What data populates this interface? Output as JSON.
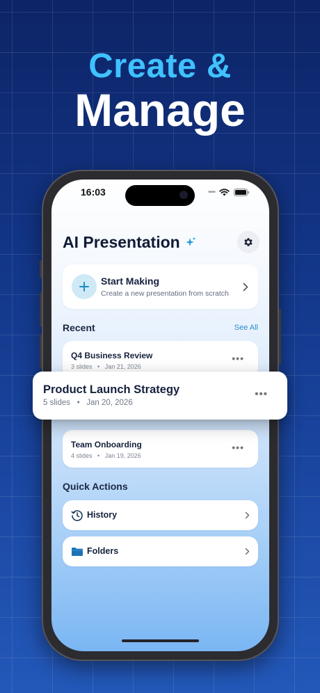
{
  "headline": {
    "line1": "Create &",
    "line2": "Manage"
  },
  "status_bar": {
    "time": "16:03",
    "icons": [
      "signal-dots-icon",
      "wifi-icon",
      "battery-icon"
    ]
  },
  "header": {
    "title": "AI Presentation",
    "sparkle_icon": "sparkle-icon",
    "settings_icon": "gear-icon"
  },
  "start_card": {
    "title": "Start Making",
    "subtitle": "Create a new presentation from scratch",
    "icon": "plus-icon"
  },
  "recent": {
    "heading": "Recent",
    "see_all": "See All",
    "items": [
      {
        "title": "Q4 Business Review",
        "slides": "3 slides",
        "date": "Jan 21, 2026"
      },
      {
        "title": "Product Launch Strategy",
        "slides": "5 slides",
        "date": "Jan 20, 2026"
      },
      {
        "title": "Team Onboarding",
        "slides": "4 slides",
        "date": "Jan 19, 2026"
      }
    ]
  },
  "quick_actions": {
    "heading": "Quick Actions",
    "items": [
      {
        "label": "History",
        "icon": "history-clock-icon"
      },
      {
        "label": "Folders",
        "icon": "folder-icon"
      }
    ]
  },
  "separator": "•",
  "more_glyph": "•••",
  "colors": {
    "accent": "#2a9bd8",
    "headline_accent": "#3fc2ff",
    "background": "#13378a"
  }
}
